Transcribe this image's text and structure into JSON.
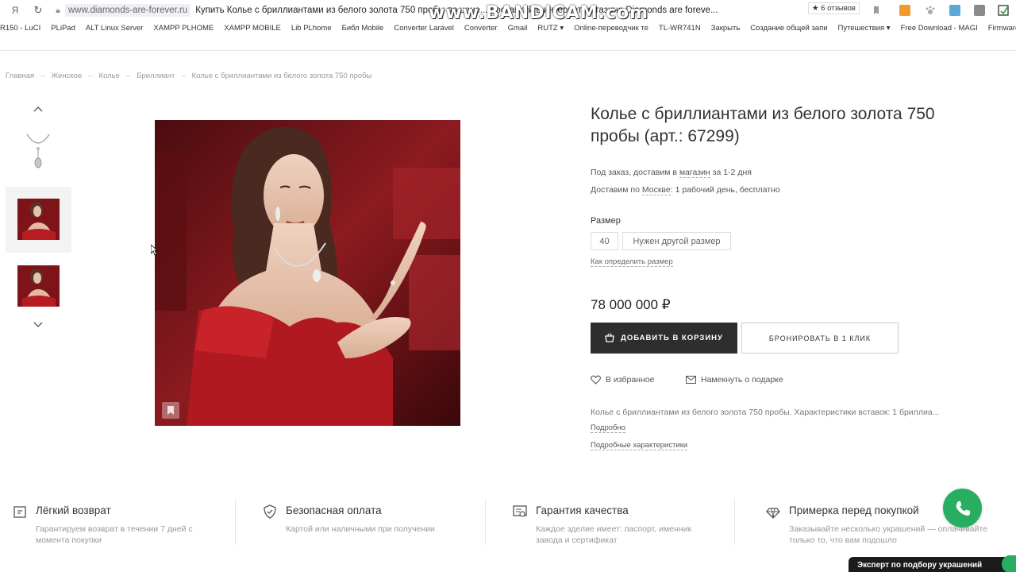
{
  "browser": {
    "yandex_glyph": "Я",
    "url": "www.diamonds-are-forever.ru",
    "tab_title": "Купить Колье с бриллиантами из белого золота 750 пробы по цене... доставкой в интернет магазине Diamonds are foreve...",
    "reviews": "★ 6 отзывов",
    "watermark": "www.BANDICAM.com",
    "bookmarks": [
      "R150 - LuCI",
      "PLiPad",
      "ALT Linux Server",
      "XAMPP PLHOME",
      "XAMPP MOBILE",
      "Lib PLhome",
      "Библ Mobile",
      "Converter Laravel",
      "Converter",
      "Gmail",
      "RUTZ ▾",
      "Online-переводчик те",
      "TL-WR741N",
      "Закрыть",
      "Создание общей запи",
      "Путешествия ▾",
      "Free Download - MAGI",
      "Firmware Releases - GL",
      "»"
    ]
  },
  "breadcrumb": [
    "Главная",
    "Женское",
    "Колье",
    "Бриллиант",
    "Колье с бриллиантами из белого золота 750 пробы"
  ],
  "breadcrumb_sep": "–",
  "product": {
    "name": "Колье с бриллиантами из белого золота 750 пробы (арт.: 67299)",
    "delivery_a": "Под заказ, доставим в ",
    "delivery_a_link": "магазин",
    "delivery_a_end": " за 1-2 дня",
    "delivery_b": "Доставим по ",
    "delivery_b_link": "Москве",
    "delivery_b_end": ": 1 рабочий день, бесплатно",
    "size_label": "Размер",
    "size_value": "40",
    "size_other": "Нужен другой размер",
    "size_help": "Как определить размер",
    "price": "78 000 000 ₽",
    "add_to_cart": "ДОБАВИТЬ В КОРЗИНУ",
    "one_click": "БРОНИРОВАТЬ В 1 КЛИК",
    "favorite": "В избранное",
    "gift_hint": "Намекнуть о подарке",
    "description": "Колье с бриллиантами из белого золота 750 пробы. Характеристики вставок: 1 бриллиа...",
    "more": "Подробно",
    "specs": "Подробные характеристики"
  },
  "benefits": [
    {
      "title": "Лёгкий возврат",
      "desc1": "Гарантируем возврат в течении 7 дней с",
      "desc2": "момента покупки"
    },
    {
      "title": "Безопасная оплата",
      "desc1": "Картой или наличными при получении",
      "desc2": ""
    },
    {
      "title": "Гарантия качества",
      "desc1": "Каждое зделие имеет: паспорт, именник",
      "desc2": "завода и сертификат"
    },
    {
      "title": "Примерка перед покупкой",
      "desc1": "Заказывайте несколько украшений — оплачивайте",
      "desc2": "только то, что вам подошло"
    }
  ],
  "expert_label": "Эксперт по подбору украшений",
  "colors": {
    "accent_dark": "#2e2e2e",
    "phone_green": "#27ae60",
    "dress_red": "#8e1a1e"
  }
}
